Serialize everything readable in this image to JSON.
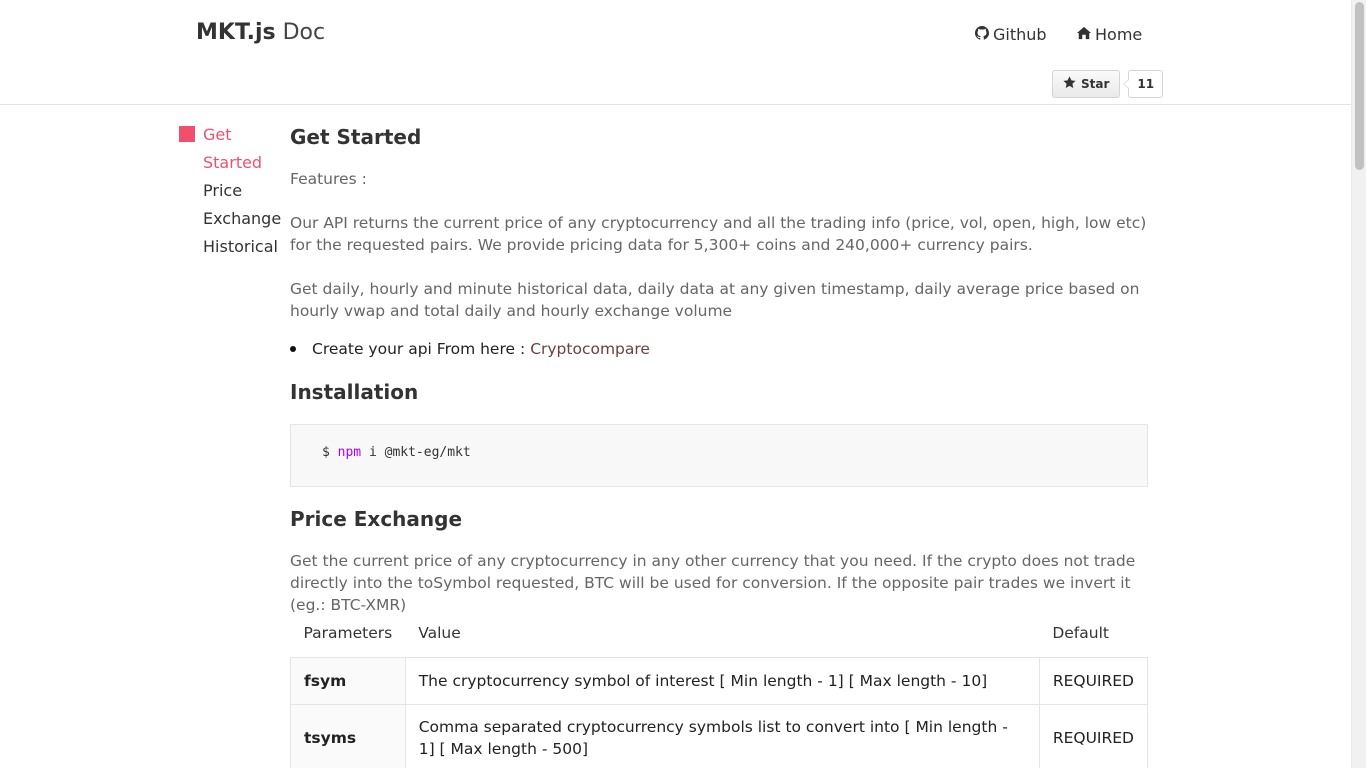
{
  "brand": {
    "name": "MKT.js",
    "suffix": "Doc"
  },
  "nav": {
    "github": "Github",
    "home": "Home"
  },
  "github_star": {
    "label": "Star",
    "count": "11"
  },
  "sidebar": {
    "items": [
      {
        "label": "Get Started",
        "active": true
      },
      {
        "label": "Price Exchange",
        "active": false
      },
      {
        "label": "Historical",
        "active": false
      }
    ]
  },
  "content": {
    "get_started_title": "Get Started",
    "features": "Features :",
    "api_paragraph": "Our API returns the current price of any cryptocurrency and all the trading info (price, vol, open, high, low etc) for the requested pairs. We provide pricing data for 5,300+ coins and 240,000+ currency pairs.",
    "historical_paragraph": "Get daily, hourly and minute historical data, daily data at any given timestamp, daily average price based on hourly vwap and total daily and hourly exchange volume",
    "bullet_text": "Create your api From here :",
    "bullet_link": "Cryptocompare",
    "installation_title": "Installation",
    "code": {
      "prompt": "$",
      "command": "npm",
      "args": "i @mkt-eg/mkt"
    },
    "price_exchange_title": "Price Exchange",
    "price_paragraph": "Get the current price of any cryptocurrency in any other currency that you need. If the crypto does not trade directly into the toSymbol requested, BTC will be used for conversion. If the opposite pair trades we invert it (eg.: BTC-XMR)",
    "table": {
      "headers": [
        "Parameters",
        "Value",
        "Default"
      ],
      "rows": [
        {
          "name": "fsym",
          "value": "The cryptocurrency symbol of interest [ Min length - 1] [ Max length - 10]",
          "default": "REQUIRED"
        },
        {
          "name": "tsyms",
          "value": "Comma separated cryptocurrency symbols list to convert into [ Min length - 1] [ Max length - 500]",
          "default": "REQUIRED"
        }
      ]
    }
  },
  "colors": {
    "accent": "#f0506e",
    "link": "#6b4141",
    "code_keyword": "#aa00ff"
  }
}
